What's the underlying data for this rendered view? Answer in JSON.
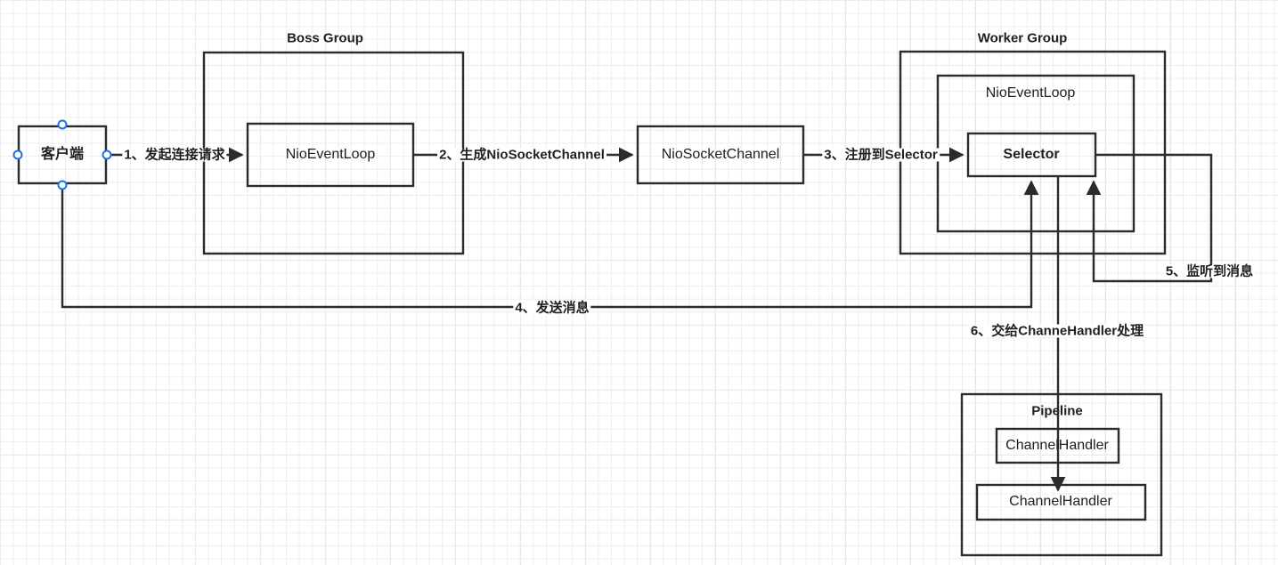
{
  "diagram": {
    "title": "Netty Boss/Worker Group NIO flow",
    "stroke_color": "#2b2b2b",
    "handle_color": "#1f72e8",
    "grid_minor_color": "#ededed",
    "grid_major_color": "#dcdcdc"
  },
  "nodes": {
    "client": {
      "label": "客户端",
      "selected": true
    },
    "boss_group": {
      "label": "Boss Group"
    },
    "boss_event_loop": {
      "label": "NioEventLoop"
    },
    "nio_socket_channel": {
      "label": "NioSocketChannel"
    },
    "worker_group": {
      "label": "Worker Group"
    },
    "worker_event_loop": {
      "label": "NioEventLoop"
    },
    "selector": {
      "label": "Selector"
    },
    "pipeline": {
      "label": "Pipeline"
    },
    "channel_handler_1": {
      "label": "ChannelHandler"
    },
    "channel_handler_2": {
      "label": "ChannelHandler"
    }
  },
  "edges": {
    "step1": {
      "label": "1、发起连接请求"
    },
    "step2": {
      "label": "2、生成NioSocketChannel"
    },
    "step3": {
      "label": "3、注册到Selector"
    },
    "step4": {
      "label": "4、发送消息"
    },
    "step5": {
      "label": "5、监听到消息"
    },
    "step6": {
      "label": "6、交给ChanneHandler处理"
    }
  },
  "handles": [
    {
      "name": "client-handle-top"
    },
    {
      "name": "client-handle-left"
    },
    {
      "name": "client-handle-right"
    },
    {
      "name": "client-handle-bottom"
    }
  ]
}
